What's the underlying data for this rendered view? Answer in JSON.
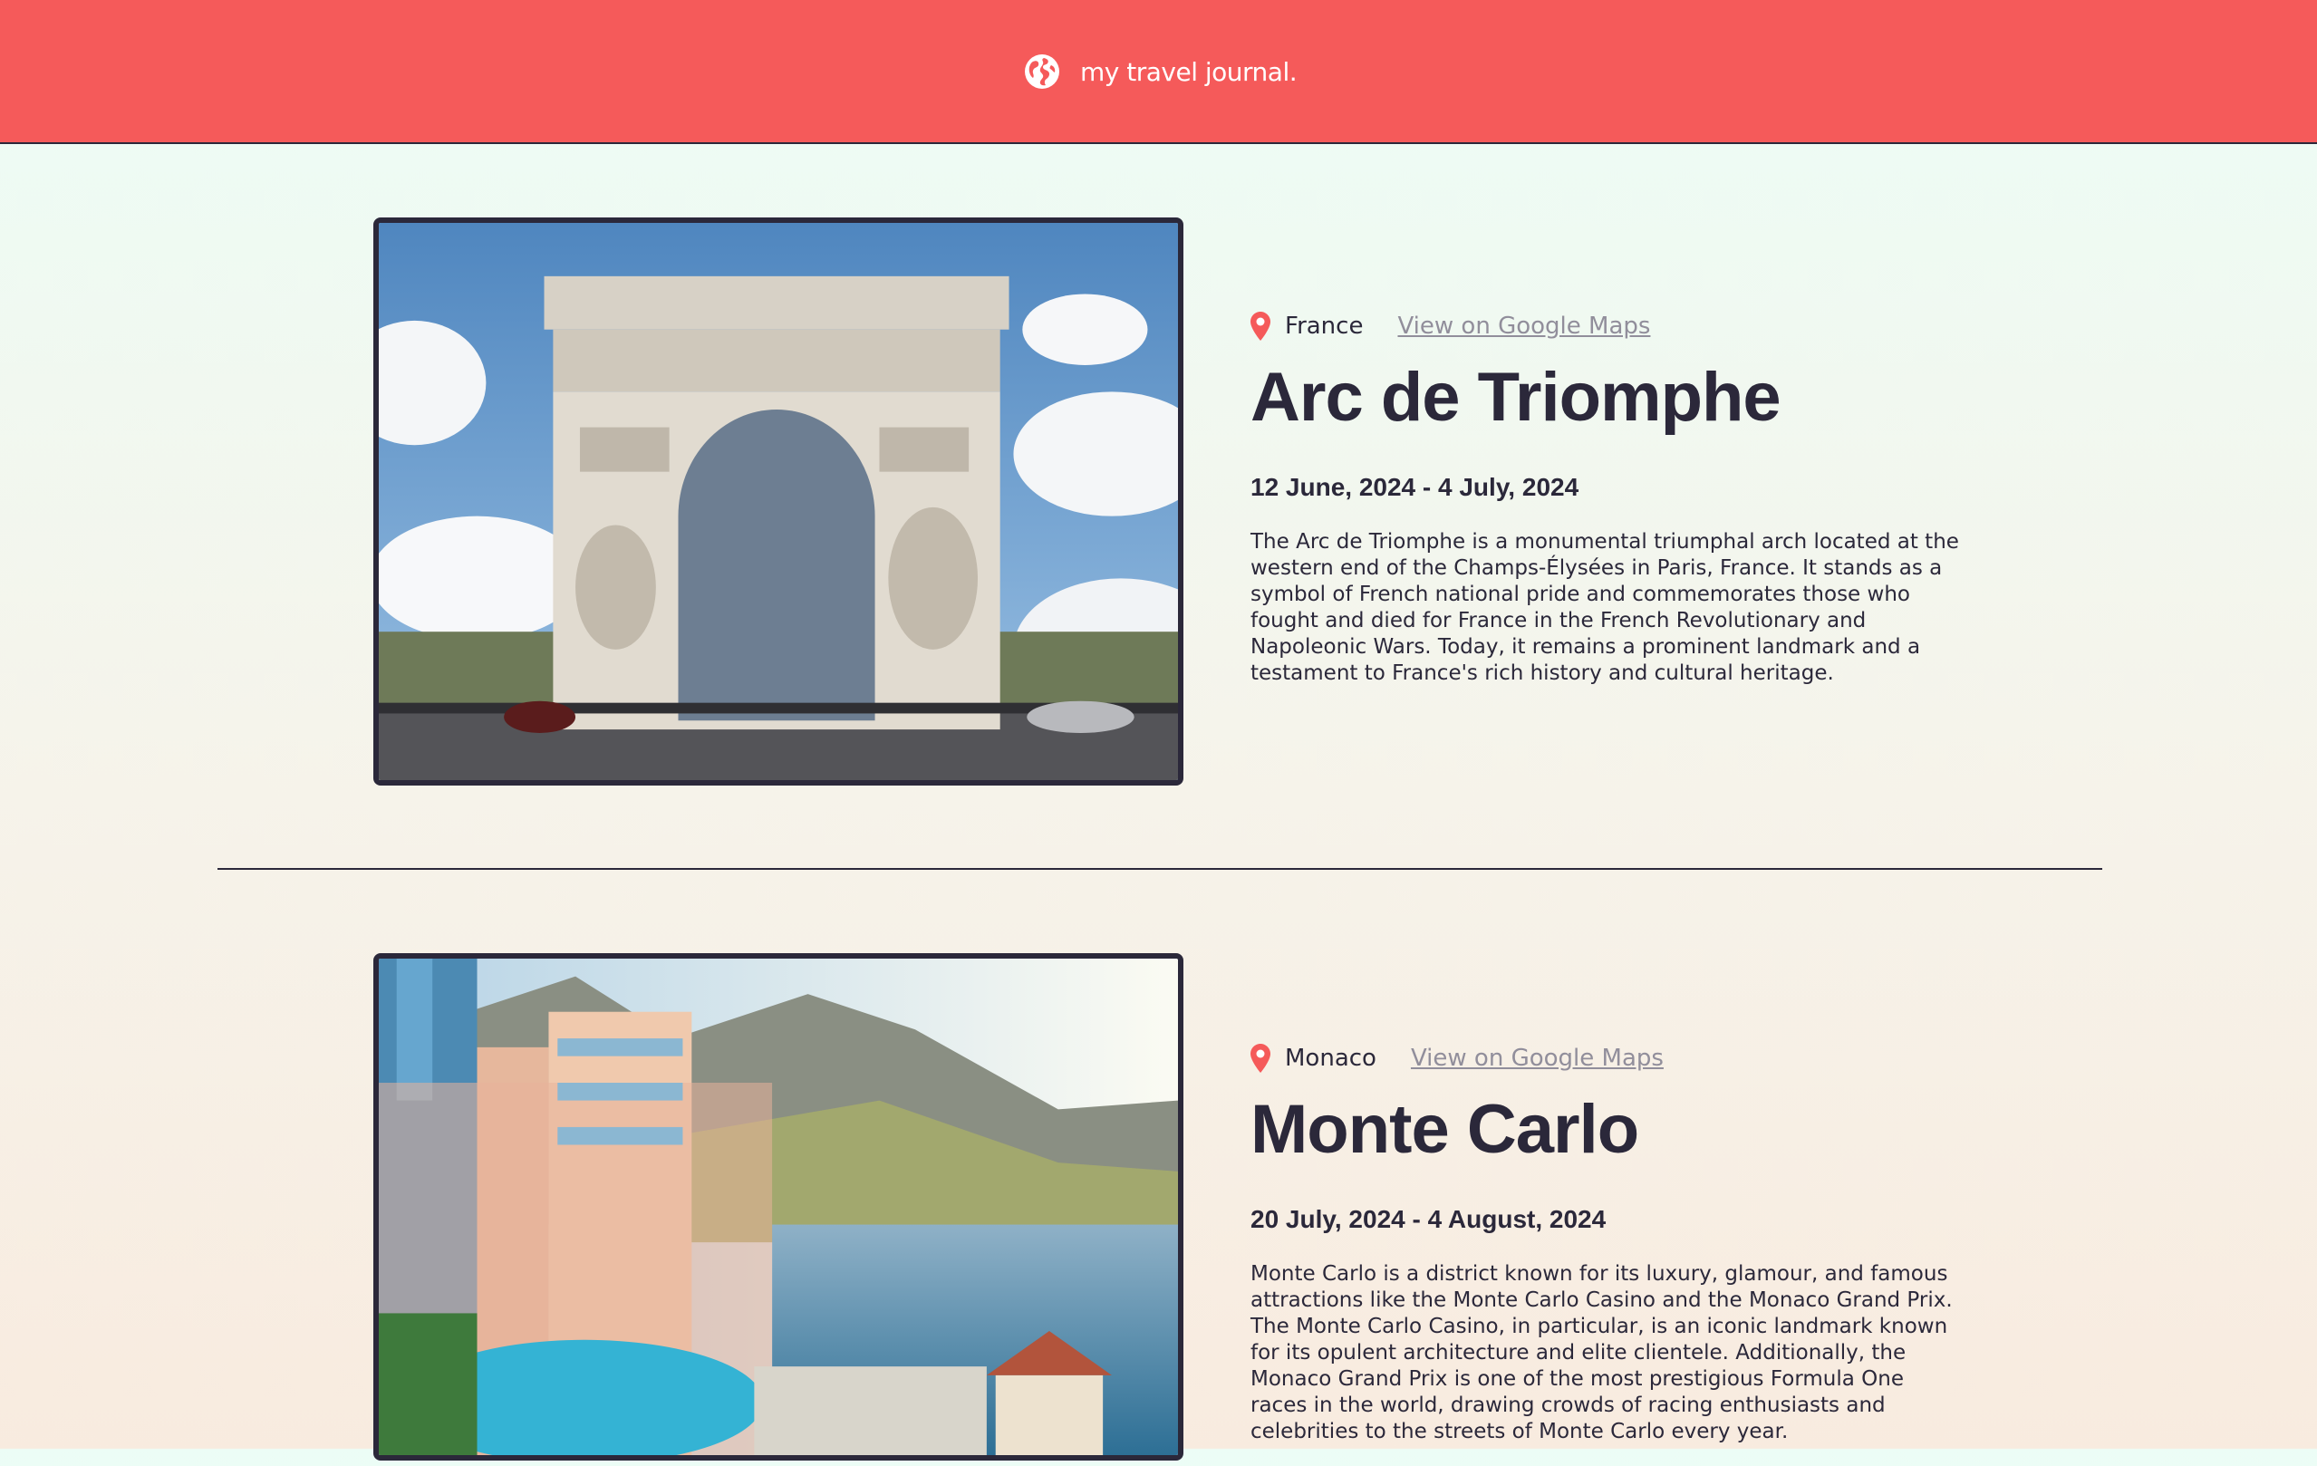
{
  "header": {
    "title": "my travel journal.",
    "icon": "globe-icon"
  },
  "colors": {
    "header_bg": "#f55a5a",
    "text_dark": "#2b283a",
    "link_gray": "#918e9b",
    "pin_red": "#f55a5a"
  },
  "entries": [
    {
      "location": "France",
      "maps_link": "View on Google Maps",
      "title": "Arc de Triomphe",
      "dates": "12 June, 2024 - 4 July, 2024",
      "description": "The Arc de Triomphe is a monumental triumphal arch located at the western end of the Champs-Élysées in Paris, France. It stands as a symbol of French national pride and commemorates those who fought and died for France in the French Revolutionary and Napoleonic Wars. Today, it remains a prominent landmark and a testament to France's rich history and cultural heritage."
    },
    {
      "location": "Monaco",
      "maps_link": "View on Google Maps",
      "title": "Monte Carlo",
      "dates": "20 July, 2024 - 4 August, 2024",
      "description": "Monte Carlo is a district known for its luxury, glamour, and famous attractions like the Monte Carlo Casino and the Monaco Grand Prix. The Monte Carlo Casino, in particular, is an iconic landmark known for its opulent architecture and elite clientele. Additionally, the Monaco Grand Prix is one of the most prestigious Formula One races in the world, drawing crowds of racing enthusiasts and celebrities to the streets of Monte Carlo every year."
    }
  ]
}
